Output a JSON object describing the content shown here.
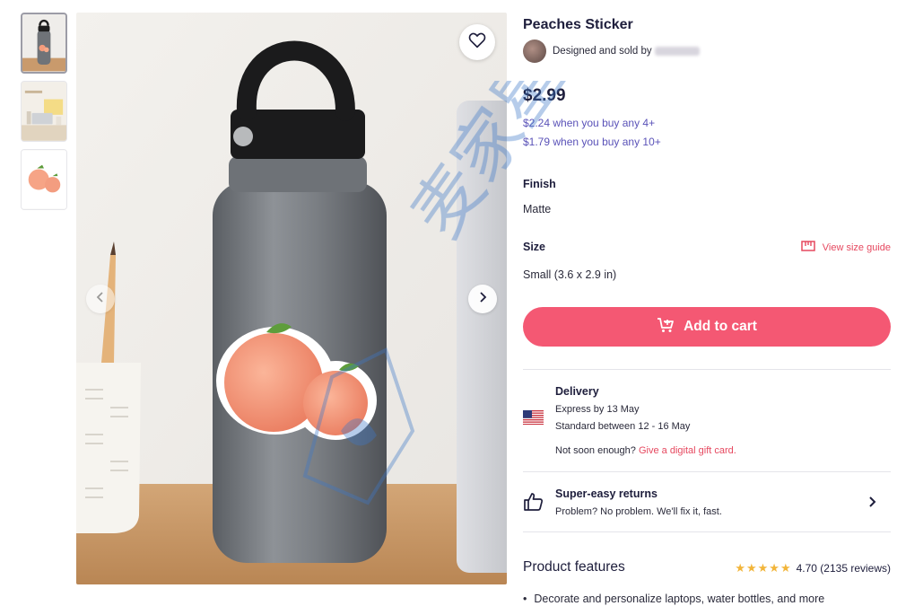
{
  "product": {
    "title": "Peaches Sticker",
    "seller_prefix": "Designed and sold by",
    "price": "$2.99",
    "bulk_4": "$2.24 when you buy any 4+",
    "bulk_10": "$1.79 when you buy any 10+"
  },
  "options": {
    "finish_label": "Finish",
    "finish_value": "Matte",
    "size_label": "Size",
    "size_value": "Small (3.6 x 2.9 in)",
    "size_guide": "View size guide"
  },
  "cart": {
    "button_label": "Add to cart"
  },
  "delivery": {
    "title": "Delivery",
    "express": "Express by 13 May",
    "standard": "Standard between 12 - 16 May",
    "not_soon": "Not soon enough?",
    "gift_link": "Give a digital gift card."
  },
  "returns": {
    "title": "Super-easy returns",
    "subtitle": "Problem? No problem. We'll fix it, fast."
  },
  "features": {
    "title": "Product features",
    "rating": "4.70",
    "reviews": "(2135 reviews)",
    "stars": 5,
    "items": [
      "Decorate and personalize laptops, water bottles, and more"
    ]
  },
  "watermark_text": "麦家星球",
  "colors": {
    "accent": "#f45873",
    "link": "#e6485f",
    "bulk": "#5a52b8",
    "star": "#f2b53a"
  },
  "icons": [
    "heart-icon",
    "chevron-left-icon",
    "chevron-right-icon",
    "ruler-icon",
    "cart-icon",
    "us-flag-icon",
    "thumbs-up-icon"
  ]
}
